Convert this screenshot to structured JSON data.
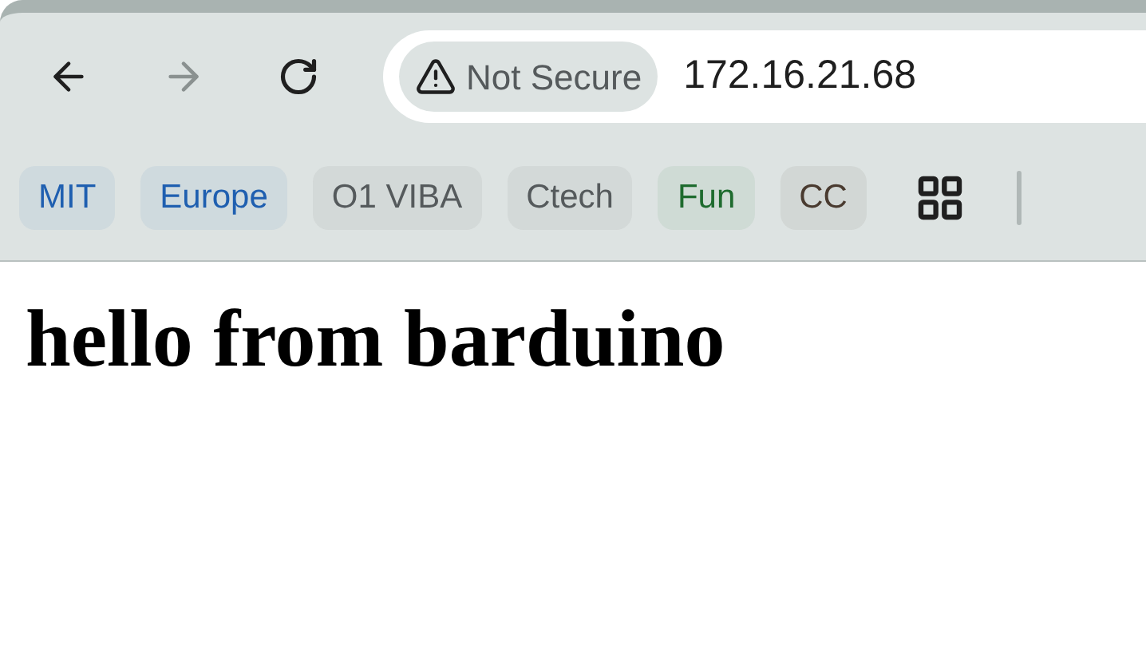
{
  "toolbar": {
    "back": {
      "disabled": false
    },
    "forward": {
      "disabled": true
    },
    "security_label": "Not Secure",
    "url": "172.16.21.68"
  },
  "bookmarks": [
    {
      "label": "MIT",
      "color": "#1f5fb0"
    },
    {
      "label": "Europe",
      "color": "#1f5fb0"
    },
    {
      "label": "O1 VIBA",
      "color": "#555a5c"
    },
    {
      "label": "Ctech",
      "color": "#555a5c"
    },
    {
      "label": "Fun",
      "color": "#1e6b2e"
    },
    {
      "label": "CC",
      "color": "#4a3b30"
    }
  ],
  "page": {
    "heading": "hello from barduino"
  }
}
